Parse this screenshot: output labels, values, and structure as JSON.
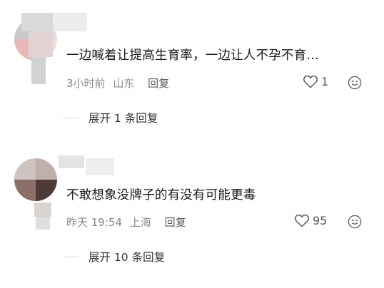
{
  "comments": [
    {
      "text": "一边喊着让提高生育率，一边让人不孕不育…",
      "time": "3小时前",
      "location": "山东",
      "reply_label": "回复",
      "likes": "1",
      "expand_label": "展开 1 条回复"
    },
    {
      "text": "不敢想象没牌子的有没有可能更毒",
      "time": "昨天 19:54",
      "location": "上海",
      "reply_label": "回复",
      "likes": "95",
      "expand_label": "展开 10 条回复"
    }
  ],
  "icons": {
    "like": "heart-outline-icon",
    "emoji": "smiley-face-icon"
  },
  "colors": {
    "text": "#1a1a1a",
    "meta": "#8a8a8a",
    "icon": "#555555"
  }
}
